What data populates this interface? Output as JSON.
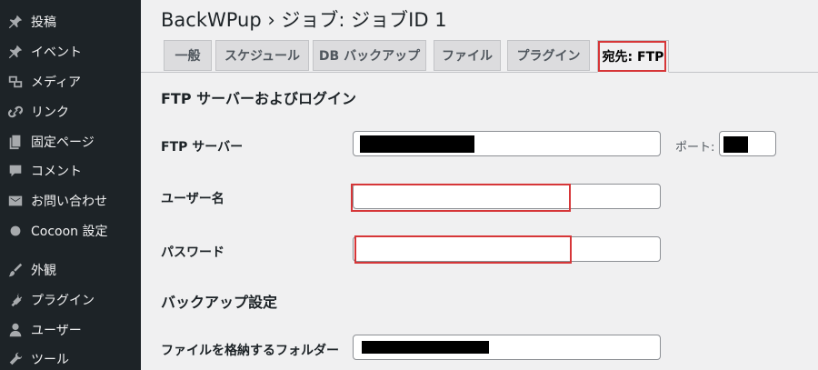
{
  "sidebar": {
    "items": [
      {
        "label": "投稿",
        "icon": "pin-icon"
      },
      {
        "label": "イベント",
        "icon": "pin-icon"
      },
      {
        "label": "メディア",
        "icon": "media-icon"
      },
      {
        "label": "リンク",
        "icon": "link-icon"
      },
      {
        "label": "固定ページ",
        "icon": "pages-icon"
      },
      {
        "label": "コメント",
        "icon": "comment-icon"
      },
      {
        "label": "お問い合わせ",
        "icon": "mail-icon"
      },
      {
        "label": "Cocoon 設定",
        "icon": "circle-icon"
      },
      {
        "label": "外観",
        "icon": "brush-icon"
      },
      {
        "label": "プラグイン",
        "icon": "plugin-icon"
      },
      {
        "label": "ユーザー",
        "icon": "user-icon"
      },
      {
        "label": "ツール",
        "icon": "wrench-icon"
      }
    ]
  },
  "page": {
    "title": "BackWPup › ジョブ: ジョブID 1"
  },
  "tabs": [
    {
      "label": "一般"
    },
    {
      "label": "スケジュール"
    },
    {
      "label": "DB バックアップ"
    },
    {
      "label": "ファイル"
    },
    {
      "label": "プラグイン"
    },
    {
      "label": "宛先: FTP"
    }
  ],
  "active_tab": "宛先: FTP",
  "ftp_section": {
    "title": "FTP サーバーおよびログイン",
    "server_label": "FTP サーバー",
    "port_label": "ポート:",
    "username_label": "ユーザー名",
    "password_label": "パスワード"
  },
  "backup_section": {
    "title": "バックアップ設定",
    "folder_label": "ファイルを格納するフォルダー"
  },
  "colors": {
    "sidebar_bg": "#1d2327",
    "highlight_red": "#d63638",
    "page_bg": "#f0f0f1"
  }
}
